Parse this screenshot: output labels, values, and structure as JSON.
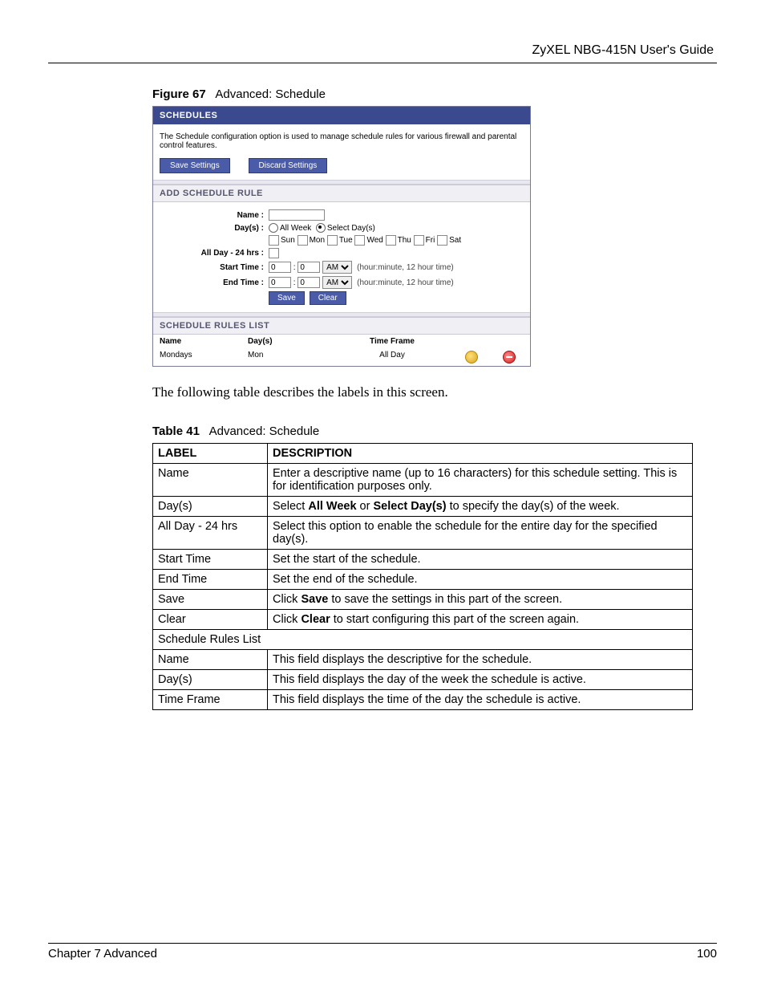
{
  "header": {
    "guide": "ZyXEL NBG-415N User's Guide"
  },
  "figure": {
    "label": "Figure 67",
    "title": "Advanced: Schedule"
  },
  "screenshot": {
    "panel_title": "SCHEDULES",
    "desc": "The Schedule configuration option is used to manage schedule rules for various firewall and parental control features.",
    "btn_save_settings": "Save Settings",
    "btn_discard_settings": "Discard Settings",
    "section_add": "ADD SCHEDULE RULE",
    "lbl_name": "Name :",
    "lbl_days": "Day(s) :",
    "radio_allweek": "All Week",
    "radio_selectdays": "Select Day(s)",
    "day_sun": "Sun",
    "day_mon": "Mon",
    "day_tue": "Tue",
    "day_wed": "Wed",
    "day_thu": "Thu",
    "day_fri": "Fri",
    "day_sat": "Sat",
    "lbl_allday": "All Day - 24 hrs :",
    "lbl_start": "Start Time :",
    "lbl_end": "End Time :",
    "val_zero": "0",
    "ampm": "AM",
    "hint_time": "(hour:minute, 12 hour time)",
    "btn_save": "Save",
    "btn_clear": "Clear",
    "section_list": "SCHEDULE RULES LIST",
    "col_name": "Name",
    "col_days": "Day(s)",
    "col_tf": "Time Frame",
    "row_name": "Mondays",
    "row_days": "Mon",
    "row_tf": "All Day"
  },
  "intro": "The following table describes the labels in this screen.",
  "table": {
    "label": "Table 41",
    "title": "Advanced: Schedule",
    "head_label": "LABEL",
    "head_desc": "DESCRIPTION",
    "rows": [
      {
        "l": "Name",
        "d": "Enter a descriptive name (up to 16 characters) for this schedule setting. This is for identification purposes only."
      },
      {
        "l": "Day(s)",
        "d_pre": "Select ",
        "d_b1": "All Week",
        "d_mid": " or ",
        "d_b2": "Select Day(s)",
        "d_post": " to specify the day(s) of the week."
      },
      {
        "l": "All Day - 24 hrs",
        "d": "Select this option to enable the schedule for the entire day for the specified day(s)."
      },
      {
        "l": "Start Time",
        "d": "Set the start of the schedule."
      },
      {
        "l": "End Time",
        "d": "Set the end of the schedule."
      },
      {
        "l": "Save",
        "d_pre": "Click ",
        "d_b1": "Save",
        "d_post": " to save the settings in this part of the screen."
      },
      {
        "l": "Clear",
        "d_pre": "Click ",
        "d_b1": "Clear",
        "d_post": " to start configuring this part of the screen again."
      },
      {
        "span": "Schedule Rules List"
      },
      {
        "l": "Name",
        "d": "This field displays the descriptive for the schedule."
      },
      {
        "l": "Day(s)",
        "d": "This field displays the day of the week the schedule is active."
      },
      {
        "l": "Time Frame",
        "d": "This field displays the time of the day the schedule is active."
      }
    ]
  },
  "footer": {
    "chapter": "Chapter 7 Advanced",
    "page": "100"
  }
}
